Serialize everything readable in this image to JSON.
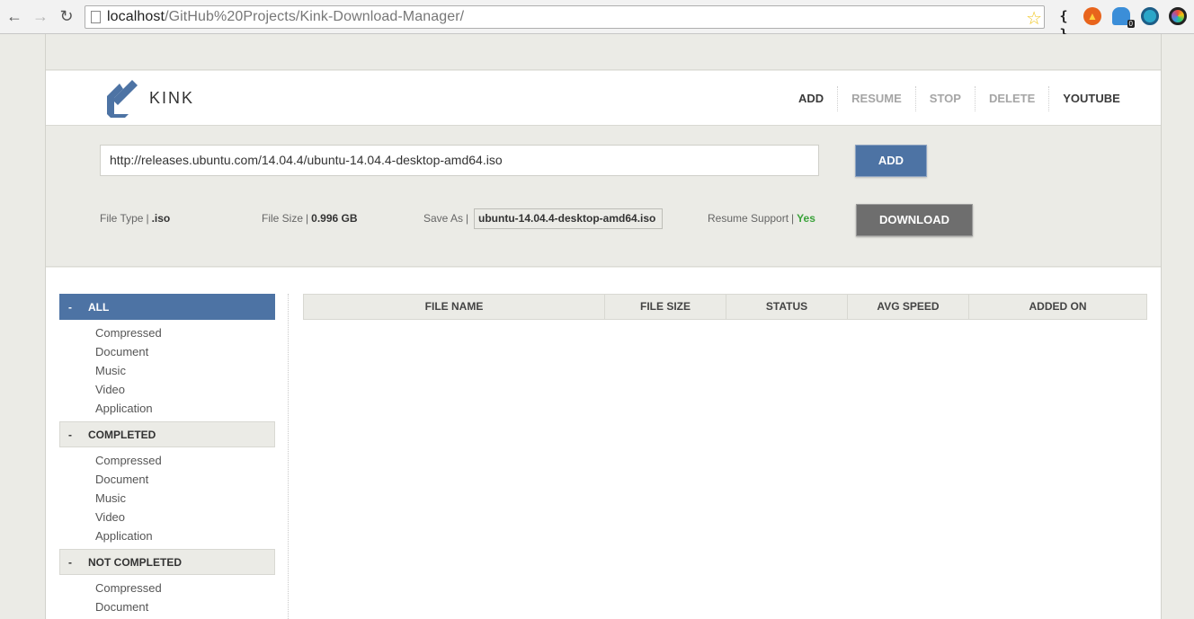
{
  "browser": {
    "url_host": "localhost",
    "url_path": "/GitHub%20Projects/Kink-Download-Manager/",
    "extensions": [
      "braces-icon",
      "fire-icon",
      "ghost-icon",
      "eye-icon",
      "disc-icon"
    ],
    "ghost_badge": "0"
  },
  "app": {
    "logo_text": "KINK"
  },
  "menu": {
    "add": "ADD",
    "resume": "RESUME",
    "stop": "STOP",
    "delete": "DELETE",
    "youtube": "YOUTUBE"
  },
  "form": {
    "url_value": "http://releases.ubuntu.com/14.04.4/ubuntu-14.04.4-desktop-amd64.iso",
    "add_button": "ADD",
    "file_type_label": "File Type",
    "file_type_value": ".iso",
    "file_size_label": "File Size",
    "file_size_value": "0.996 GB",
    "save_as_label": "Save As",
    "save_as_value": "ubuntu-14.04.4-desktop-amd64.iso",
    "resume_label": "Resume Support",
    "resume_value": "Yes",
    "separator": "|",
    "download_button": "DOWNLOAD"
  },
  "sidebar": {
    "dash": "-",
    "groups": [
      {
        "label": "ALL",
        "items": [
          "Compressed",
          "Document",
          "Music",
          "Video",
          "Application"
        ]
      },
      {
        "label": "COMPLETED",
        "items": [
          "Compressed",
          "Document",
          "Music",
          "Video",
          "Application"
        ]
      },
      {
        "label": "NOT COMPLETED",
        "items": [
          "Compressed",
          "Document"
        ]
      }
    ]
  },
  "table": {
    "columns": [
      "FILE NAME",
      "FILE SIZE",
      "STATUS",
      "AVG SPEED",
      "ADDED ON"
    ]
  },
  "colors": {
    "accent": "#4d73a4",
    "success": "#3aa23a",
    "download_button": "#6e6e6e"
  }
}
